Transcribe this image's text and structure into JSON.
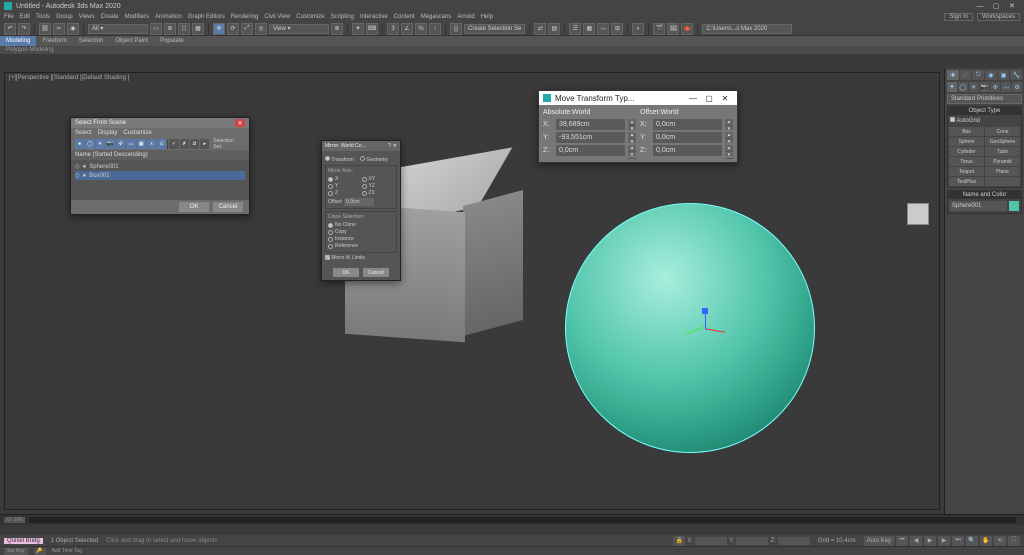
{
  "titlebar": {
    "title": "Untitled - Autodesk 3ds Max 2020",
    "signin": "Sign In",
    "workspaces": "Workspaces"
  },
  "menu": {
    "items": [
      "File",
      "Edit",
      "Tools",
      "Group",
      "Views",
      "Create",
      "Modifiers",
      "Animation",
      "Graph Editors",
      "Rendering",
      "Civil View",
      "Customize",
      "Scripting",
      "Interactive",
      "Content",
      "Megascans",
      "Arnold",
      "Help"
    ],
    "path": "C:\\Users\\...s Max 2020"
  },
  "toolbar": {
    "selectionSet": "Create Selection Se"
  },
  "ribbon": {
    "tabs": [
      "Modeling",
      "Freeform",
      "Selection",
      "Object Paint",
      "Populate"
    ],
    "sub": "Polygon Modeling"
  },
  "viewport": {
    "label": "[+][Perspective ][Standard ][Default Shading ]"
  },
  "cmdpanel": {
    "category": "Standard Primitives",
    "objtype": "Object Type",
    "autogrid": "AutoGrid",
    "buttons": [
      "Box",
      "Cone",
      "Sphere",
      "GeoSphere",
      "Cylinder",
      "Tube",
      "Torus",
      "Pyramid",
      "Teapot",
      "Plane",
      "TextPlus"
    ],
    "nameHdr": "Name and Color",
    "name": "Sphere001"
  },
  "sfs": {
    "title": "Select From Scene",
    "menu": [
      "Select",
      "Display",
      "Customize"
    ],
    "searchLabel": "Selection Set:",
    "col": "Name (Sorted Descending)",
    "items": [
      "Sphere001",
      "Box001"
    ],
    "ok": "OK",
    "cancel": "Cancel"
  },
  "mirror": {
    "title": "Mirror: World Co...",
    "modeTransform": "Transform",
    "modeGeometry": "Geometry",
    "axisHdr": "Mirror Axis:",
    "axes": [
      "X",
      "XY",
      "Y",
      "YZ",
      "Z",
      "ZX"
    ],
    "offsetLbl": "Offset:",
    "offset": "0,0cm",
    "cloneHdr": "Clone Selection:",
    "clones": [
      "No Clone",
      "Copy",
      "Instance",
      "Reference"
    ],
    "ik": "Mirror IK Limits",
    "ok": "OK",
    "cancel": "Cancel"
  },
  "move": {
    "title": "Move Transform Typ...",
    "absHdr": "Absolute:World",
    "offHdr": "Offset:World",
    "axisLbl": {
      "x": "X:",
      "y": "Y:",
      "z": "Z:"
    },
    "abs": {
      "x": "39,689cm",
      "y": "-93,551cm",
      "z": "0,0cm"
    },
    "off": {
      "x": "0,0cm",
      "y": "0,0cm",
      "z": "0,0cm"
    }
  },
  "timeline": {
    "pos": "0 / 100"
  },
  "status": {
    "left": "Quixel Bridg",
    "selected": "1 Object Selected",
    "hint": "Click and drag to select and move objects",
    "coords": {
      "x": "X:",
      "y": "Y:",
      "z": "Z:"
    },
    "grid": "Grid = 10,4cm",
    "autokey": "Auto Key",
    "setkey": "Set Key",
    "addtag": "Add Time Tag"
  }
}
